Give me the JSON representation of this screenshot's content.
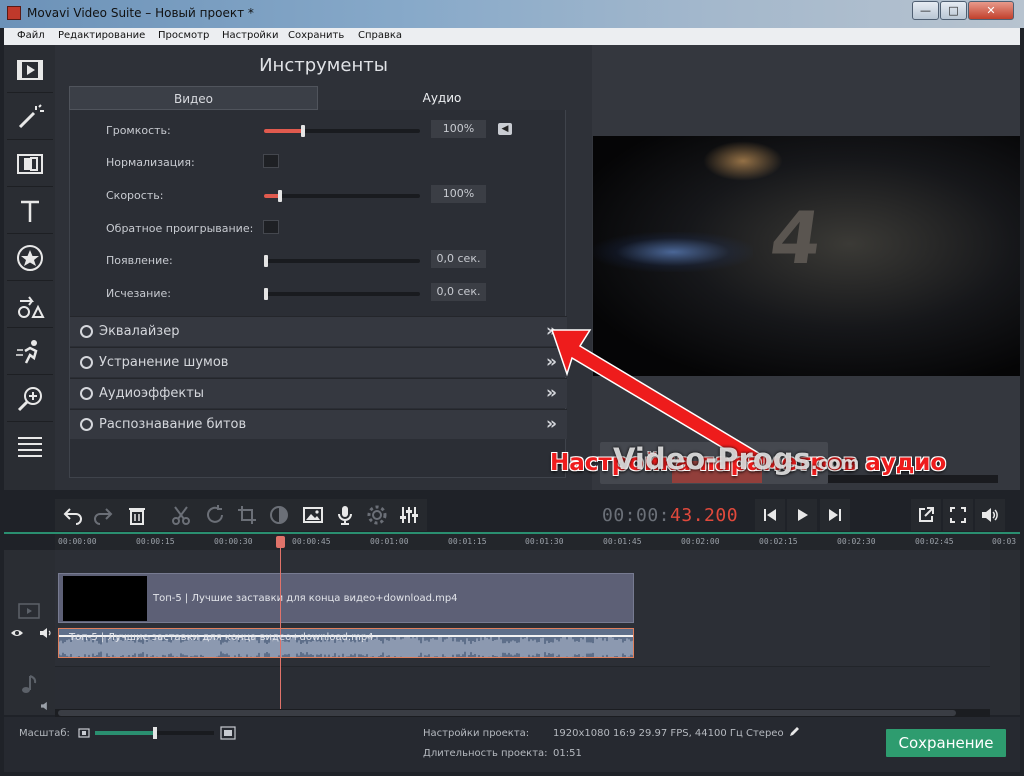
{
  "window": {
    "title": "Movavi Video Suite – Новый проект *",
    "minimize": "—",
    "maximize": "□",
    "close": "✕"
  },
  "menu": [
    "Файл",
    "Редактирование",
    "Просмотр",
    "Настройки",
    "Сохранить",
    "Справка"
  ],
  "sidebar": {
    "items": [
      "film-icon",
      "magic-wand-icon",
      "transitions-icon",
      "text-icon",
      "sticker-icon",
      "shapes-icon",
      "motion-icon",
      "zoom-icon",
      "list-icon"
    ]
  },
  "tools": {
    "title": "Инструменты",
    "tabs": {
      "video": "Видео",
      "audio": "Аудио"
    },
    "rows": {
      "volume": {
        "label": "Громкость:",
        "value": "100%",
        "level": 0.25
      },
      "normalize": {
        "label": "Нормализация:"
      },
      "speed": {
        "label": "Скорость:",
        "value": "100%",
        "level": 0.1
      },
      "reverse": {
        "label": "Обратное проигрывание:"
      },
      "fadein": {
        "label": "Появление:",
        "value": "0,0 сек.",
        "level": 0
      },
      "fadeout": {
        "label": "Исчезание:",
        "value": "0,0 сек.",
        "level": 0
      }
    },
    "accordions": [
      "Эквалайзер",
      "Устранение шумов",
      "Аудиоэффекты",
      "Распознавание битов"
    ],
    "chevron": "»"
  },
  "preview": {
    "big_text": "4",
    "annotation": "Настройка параметров аудио",
    "watermark": "Video-Progs",
    "watermark_suffix": ".com"
  },
  "playback": {
    "time_grey": "00:00:",
    "time_red": "43.200"
  },
  "ruler": [
    "00:00:00",
    "00:00:15",
    "00:00:30",
    "00:00:45",
    "00:01:00",
    "00:01:15",
    "00:01:30",
    "00:01:45",
    "00:02:00",
    "00:02:15",
    "00:02:30",
    "00:02:45",
    "00:03"
  ],
  "timeline": {
    "video_clip": "Топ-5 | Лучшие заставки для конца видео+download.mp4",
    "audio_clip": "Топ-5 | Лучшие заставки для конца видео+download.mp4"
  },
  "status": {
    "zoom_label": "Масштаб:",
    "project_settings_label": "Настройки проекта:",
    "project_settings_value": "1920x1080 16:9 29.97 FPS, 44100 Гц Стерео",
    "duration_label": "Длительность проекта:",
    "duration_value": "01:51",
    "save_button": "Сохранение"
  },
  "colors": {
    "accent_red": "#e05a4e",
    "accent_green": "#2e9c6f",
    "annotation_red": "#ee1c1c"
  }
}
